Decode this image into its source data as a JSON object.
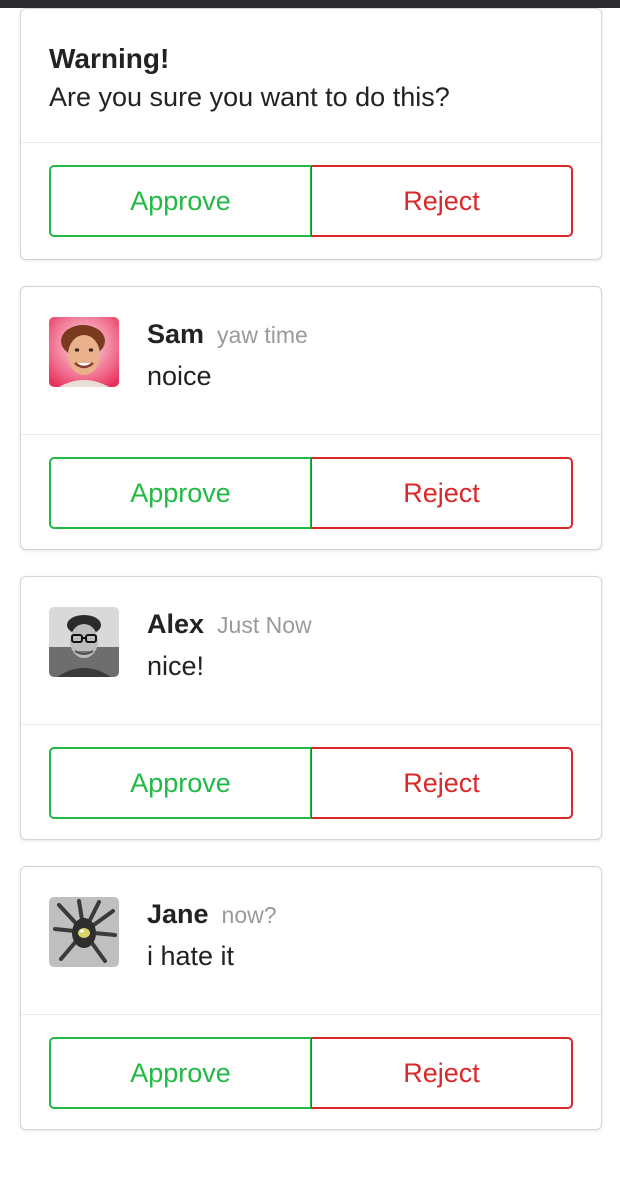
{
  "warning": {
    "title": "Warning!",
    "text": "Are you sure you want to do this?",
    "approve_label": "Approve",
    "reject_label": "Reject"
  },
  "comments": [
    {
      "author": "Sam",
      "meta": "yaw time",
      "text": "noice",
      "avatar_icon": "avatar-photo-red-background",
      "approve_label": "Approve",
      "reject_label": "Reject"
    },
    {
      "author": "Alex",
      "meta": "Just Now",
      "text": "nice!",
      "avatar_icon": "avatar-photo-grayscale",
      "approve_label": "Approve",
      "reject_label": "Reject"
    },
    {
      "author": "Jane",
      "meta": "now?",
      "text": "i hate it",
      "avatar_icon": "avatar-robot-spider",
      "approve_label": "Approve",
      "reject_label": "Reject"
    }
  ],
  "colors": {
    "approve": "#21ba45",
    "reject": "#db2828",
    "meta_text": "#9a9a9a",
    "topbar": "#2b2b2e"
  }
}
